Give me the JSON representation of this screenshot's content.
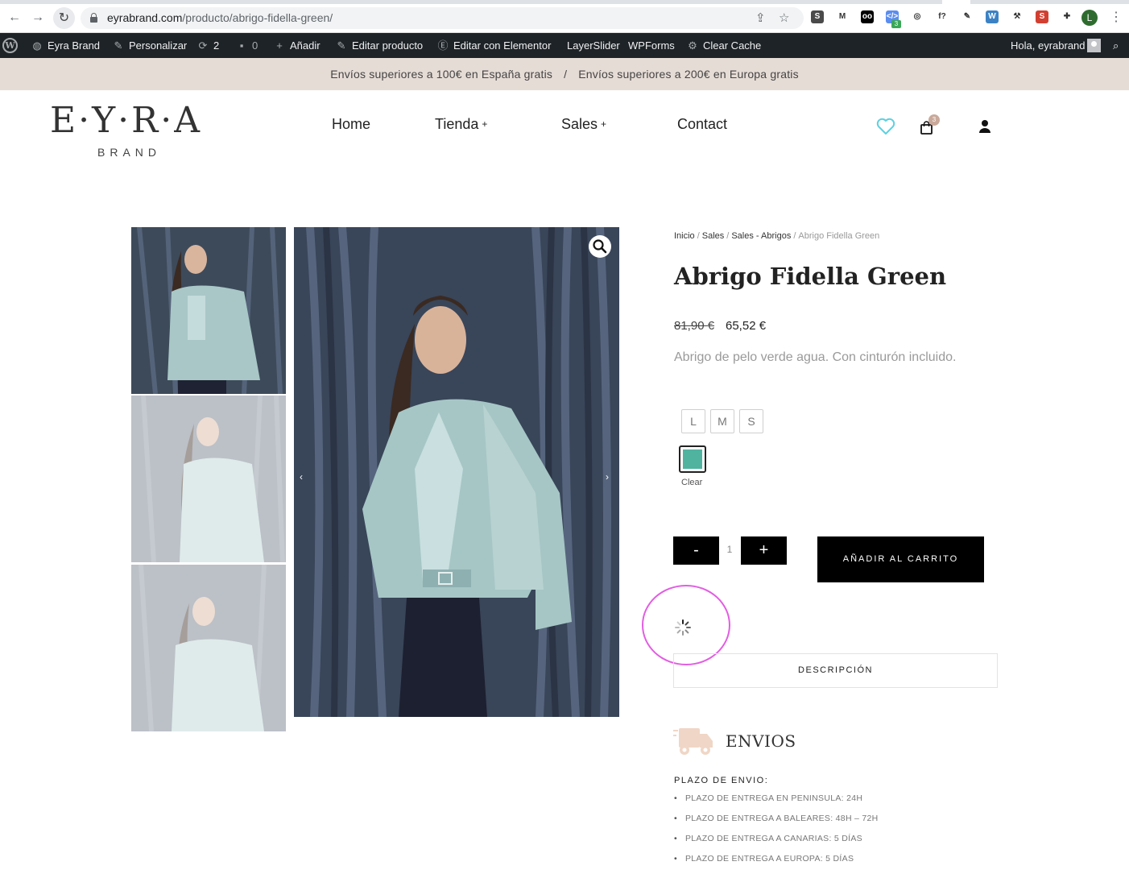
{
  "browser": {
    "url_host": "eyrabrand.com",
    "url_path": "/producto/abrigo-fidella-green/",
    "extension_badge": "3",
    "profile_initial": "L",
    "extensions": [
      {
        "name": "s-ext-icon",
        "label": "S",
        "color": "#4a4a4a"
      },
      {
        "name": "movistar-ext-icon",
        "label": "M",
        "color": "#ffffff"
      },
      {
        "name": "oo-ext-icon",
        "label": "oo",
        "color": "#000000"
      },
      {
        "name": "code-ext-icon",
        "label": "</>",
        "color": "#5b8def"
      },
      {
        "name": "radar-ext-icon",
        "label": "◎",
        "color": "#ffffff"
      },
      {
        "name": "font-ext-icon",
        "label": "f?",
        "color": "#ffffff"
      },
      {
        "name": "picker-ext-icon",
        "label": "✎",
        "color": "#ffffff"
      },
      {
        "name": "wordpress-ext-icon",
        "label": "W",
        "color": "#3b82c4"
      },
      {
        "name": "hammer-ext-icon",
        "label": "⚒",
        "color": "#ffffff"
      },
      {
        "name": "s-red-ext-icon",
        "label": "S",
        "color": "#d23f31"
      },
      {
        "name": "puzzle-ext-icon",
        "label": "✚",
        "color": "#ffffff"
      }
    ]
  },
  "adminbar": {
    "site_name": "Eyra Brand",
    "customize": "Personalizar",
    "updates": "2",
    "comments": "0",
    "add_new": "Añadir",
    "edit_product": "Editar producto",
    "elementor": "Editar con Elementor",
    "layerslider": "LayerSlider",
    "wpforms": "WPForms",
    "clear_cache": "Clear Cache",
    "greeting": "Hola, ",
    "username": "eyrabrand"
  },
  "promo": {
    "spain": "Envíos superiores a 100€ en España gratis",
    "separator": "/",
    "europe": "Envíos superiores a 200€ en Europa gratis"
  },
  "header": {
    "logo_main": "E·Y·R·A",
    "logo_sub": "BRAND",
    "menu": [
      {
        "label": "Home",
        "plus": ""
      },
      {
        "label": "Tienda",
        "plus": "+"
      },
      {
        "label": "Sales",
        "plus": "+"
      },
      {
        "label": "Contact",
        "plus": ""
      }
    ],
    "cart_count": "3",
    "colors": {
      "heart": "#5fd0e0",
      "badge": "#c9a99a"
    }
  },
  "gallery": {
    "arrow_prev": "‹",
    "arrow_next": "›"
  },
  "product": {
    "breadcrumb": [
      "Inicio",
      "Sales",
      "Sales - Abrigos",
      "Abrigo Fidella Green"
    ],
    "title": "Abrigo Fidella Green",
    "price_regular": "81,90 €",
    "price_sale": "65,52 €",
    "short_description": "Abrigo de pelo verde agua. Con cinturón incluido.",
    "sizes": [
      "L",
      "M",
      "S"
    ],
    "color_swatch": "#4fb3a0",
    "clear_label": "Clear",
    "qty_minus": "-",
    "qty_value": "1",
    "qty_plus": "+",
    "add_to_cart": "AÑADIR AL CARRITO",
    "tab_description": "DESCRIPCIÓN"
  },
  "shipping": {
    "title": "ENVIOS",
    "subtitle": "PLAZO DE ENVIO:",
    "items": [
      "PLAZO DE ENTREGA EN PENINSULA: 24H",
      "PLAZO DE ENTREGA A BALEARES: 48H – 72H",
      "PLAZO DE ENTREGA A CANARIAS: 5 DÍAS",
      "PLAZO DE ENTREGA A EUROPA: 5 DÍAS"
    ]
  },
  "annotation": {
    "highlight_color": "#e25ee2"
  }
}
